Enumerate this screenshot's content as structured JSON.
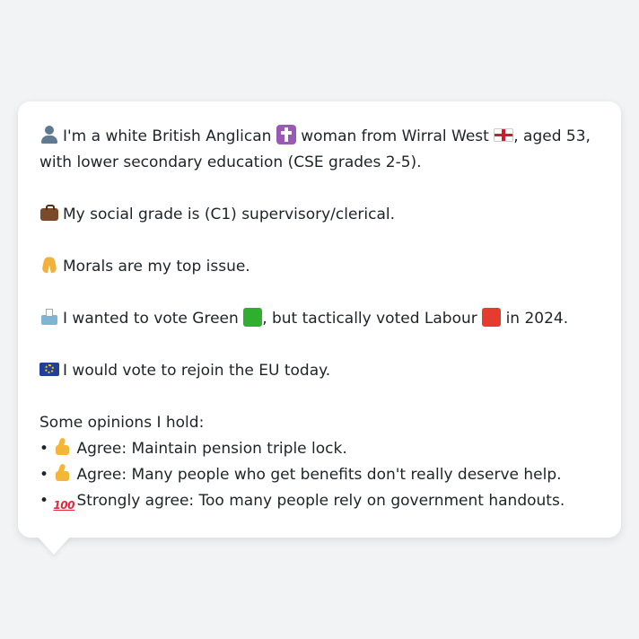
{
  "profile": {
    "line1_part1": "I'm a white British Anglican",
    "line1_part2": "woman from Wirral West",
    "line1_part3": ", aged 53,",
    "line2": "with lower secondary education (CSE grades 2-5).",
    "social_grade": "My social grade is (C1) supervisory/clerical.",
    "top_issue": "Morals are my top issue.",
    "vote_part1": "I wanted to vote Green",
    "vote_part2": ", but tactically voted Labour",
    "vote_part3": "in 2024.",
    "eu": "I would vote to rejoin the EU today.",
    "opinions_heading": "Some opinions I hold:",
    "opinions": [
      {
        "bullet": "•",
        "icon": "thumbs-up-icon",
        "text": "Agree: Maintain pension triple lock."
      },
      {
        "bullet": "•",
        "icon": "thumbs-up-icon",
        "text": "Agree: Many people who get benefits don't really deserve help."
      },
      {
        "bullet": "•",
        "icon": "hundred-points-icon",
        "icon_text": "100",
        "text": "Strongly agree: Too many people rely on government handouts."
      }
    ]
  },
  "icons": {
    "person": "person-silhouette-icon",
    "religion": "latin-cross-icon",
    "flag": "england-flag-icon",
    "work": "briefcase-icon",
    "issue": "praying-hands-icon",
    "vote": "ballot-box-icon",
    "green": "green-square-icon",
    "labour": "red-square-icon",
    "eu": "eu-flag-icon"
  },
  "colors": {
    "background": "#f2f3f5",
    "bubble": "#ffffff",
    "text": "#1f2328",
    "green": "#2fae2f",
    "red": "#e43c2f"
  }
}
